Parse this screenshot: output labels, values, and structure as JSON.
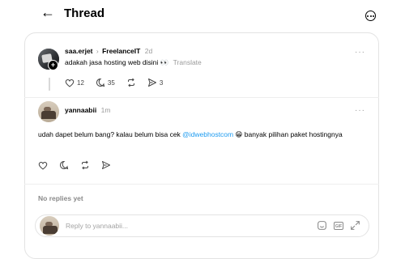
{
  "header": {
    "back_glyph": "←",
    "title": "Thread"
  },
  "parent_post": {
    "username": "saa.erjet",
    "separator": "›",
    "community": "FreelanceIT",
    "time": "2d",
    "text": "adakah jasa hosting web disini",
    "emoji": "👀",
    "translate": "Translate",
    "likes": "12",
    "comments": "35",
    "shares": "3"
  },
  "reply_post": {
    "username": "yannaabii",
    "time": "1m",
    "text_before_link": "udah dapet belum bang? kalau belum bisa cek ",
    "link": "@idwebhostcom",
    "text_after_link": " banyak pilihan paket hostingnya",
    "emoji": "😁"
  },
  "no_replies_text": "No replies yet",
  "reply_box": {
    "placeholder": "Reply to yannaabii...",
    "gif_label": "GIF"
  },
  "icons": {
    "back": "arrow-left-icon",
    "more": "more-circle-icon",
    "like": "heart-icon",
    "comment": "comment-icon",
    "repost": "repost-icon",
    "share": "send-icon",
    "sticker": "sticker-icon",
    "gif": "gif-icon",
    "expand": "expand-icon"
  },
  "colors": {
    "link": "#1d9bf0",
    "muted": "#9a9a9a",
    "border": "#e3e3e3"
  }
}
